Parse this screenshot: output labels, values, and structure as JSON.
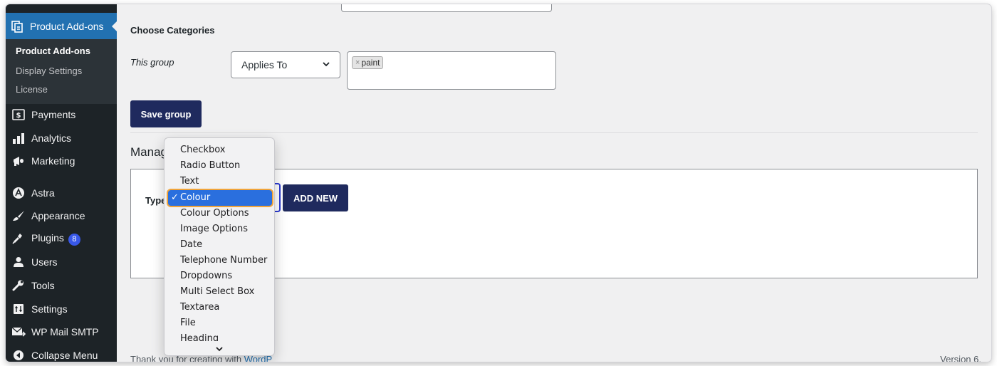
{
  "sidebar": {
    "current_label": "Product Add-ons",
    "submenu": [
      "Product Add-ons",
      "Display Settings",
      "License"
    ],
    "items": [
      {
        "label": "Payments",
        "icon": "dollar-icon"
      },
      {
        "label": "Analytics",
        "icon": "bar-chart-icon"
      },
      {
        "label": "Marketing",
        "icon": "megaphone-icon"
      },
      {
        "label": "Astra",
        "icon": "astra-icon"
      },
      {
        "label": "Appearance",
        "icon": "paintbrush-icon"
      },
      {
        "label": "Plugins",
        "icon": "plugin-icon",
        "badge": "8"
      },
      {
        "label": "Users",
        "icon": "user-icon"
      },
      {
        "label": "Tools",
        "icon": "wrench-icon"
      },
      {
        "label": "Settings",
        "icon": "settings-icon"
      },
      {
        "label": "WP Mail SMTP",
        "icon": "mail-icon"
      },
      {
        "label": "Collapse Menu",
        "icon": "collapse-icon"
      }
    ]
  },
  "main": {
    "section_title": "Choose Categories",
    "row_label": "This group",
    "applies_to_value": "Applies To",
    "tags": [
      "paint"
    ],
    "tag_remove_glyph": "×",
    "save_button": "Save group",
    "manage_title_visible": "Manag",
    "type_label_visible": "Type",
    "add_new_button": "ADD NEW",
    "footer_text_visible": "Thank you for creating with ",
    "footer_link_visible": "WordP",
    "footer_version_visible": "Version 6."
  },
  "dropdown": {
    "options": [
      "Checkbox",
      "Radio Button",
      "Text",
      "Colour",
      "Colour Options",
      "Image Options",
      "Date",
      "Telephone Number",
      "Dropdowns",
      "Multi Select Box",
      "Textarea",
      "File",
      "Heading"
    ],
    "selected": "Colour",
    "check_glyph": "✓"
  },
  "colors": {
    "sidebar_bg": "#1d2327",
    "sidebar_active": "#2271b1",
    "primary_button": "#1f2a5e",
    "selection": "#2a6fde",
    "highlight_outline": "#f0a43a",
    "badge": "#3858e9"
  }
}
